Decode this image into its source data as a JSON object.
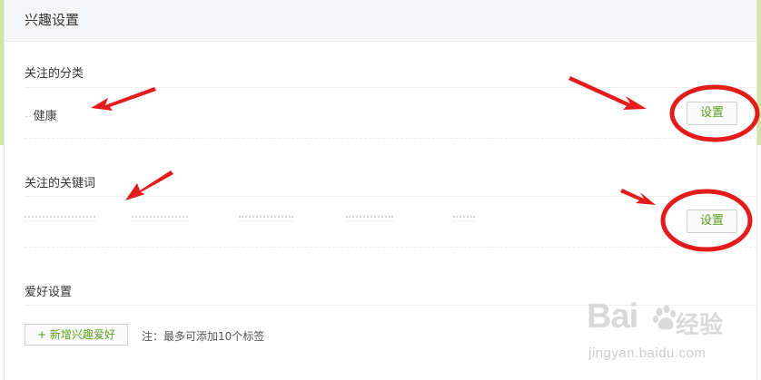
{
  "panel": {
    "title": "兴趣设置"
  },
  "categories": {
    "section_title": "关注的分类",
    "item_label": "健康",
    "set_button": "设置"
  },
  "keywords": {
    "section_title": "关注的关键词",
    "set_button": "设置"
  },
  "hobbies": {
    "section_title": "爱好设置",
    "add_button": "+ 新增兴趣爱好",
    "hint": "注：最多可添加10个标签"
  },
  "watermark": {
    "brand": "Bai",
    "brand_cn": "经验",
    "url": "jingyan.baidu.com"
  },
  "colors": {
    "accent_green": "#5a9e1e",
    "annotation_red": "#e31b1b",
    "page_edge_green": "#cfe6a4"
  }
}
